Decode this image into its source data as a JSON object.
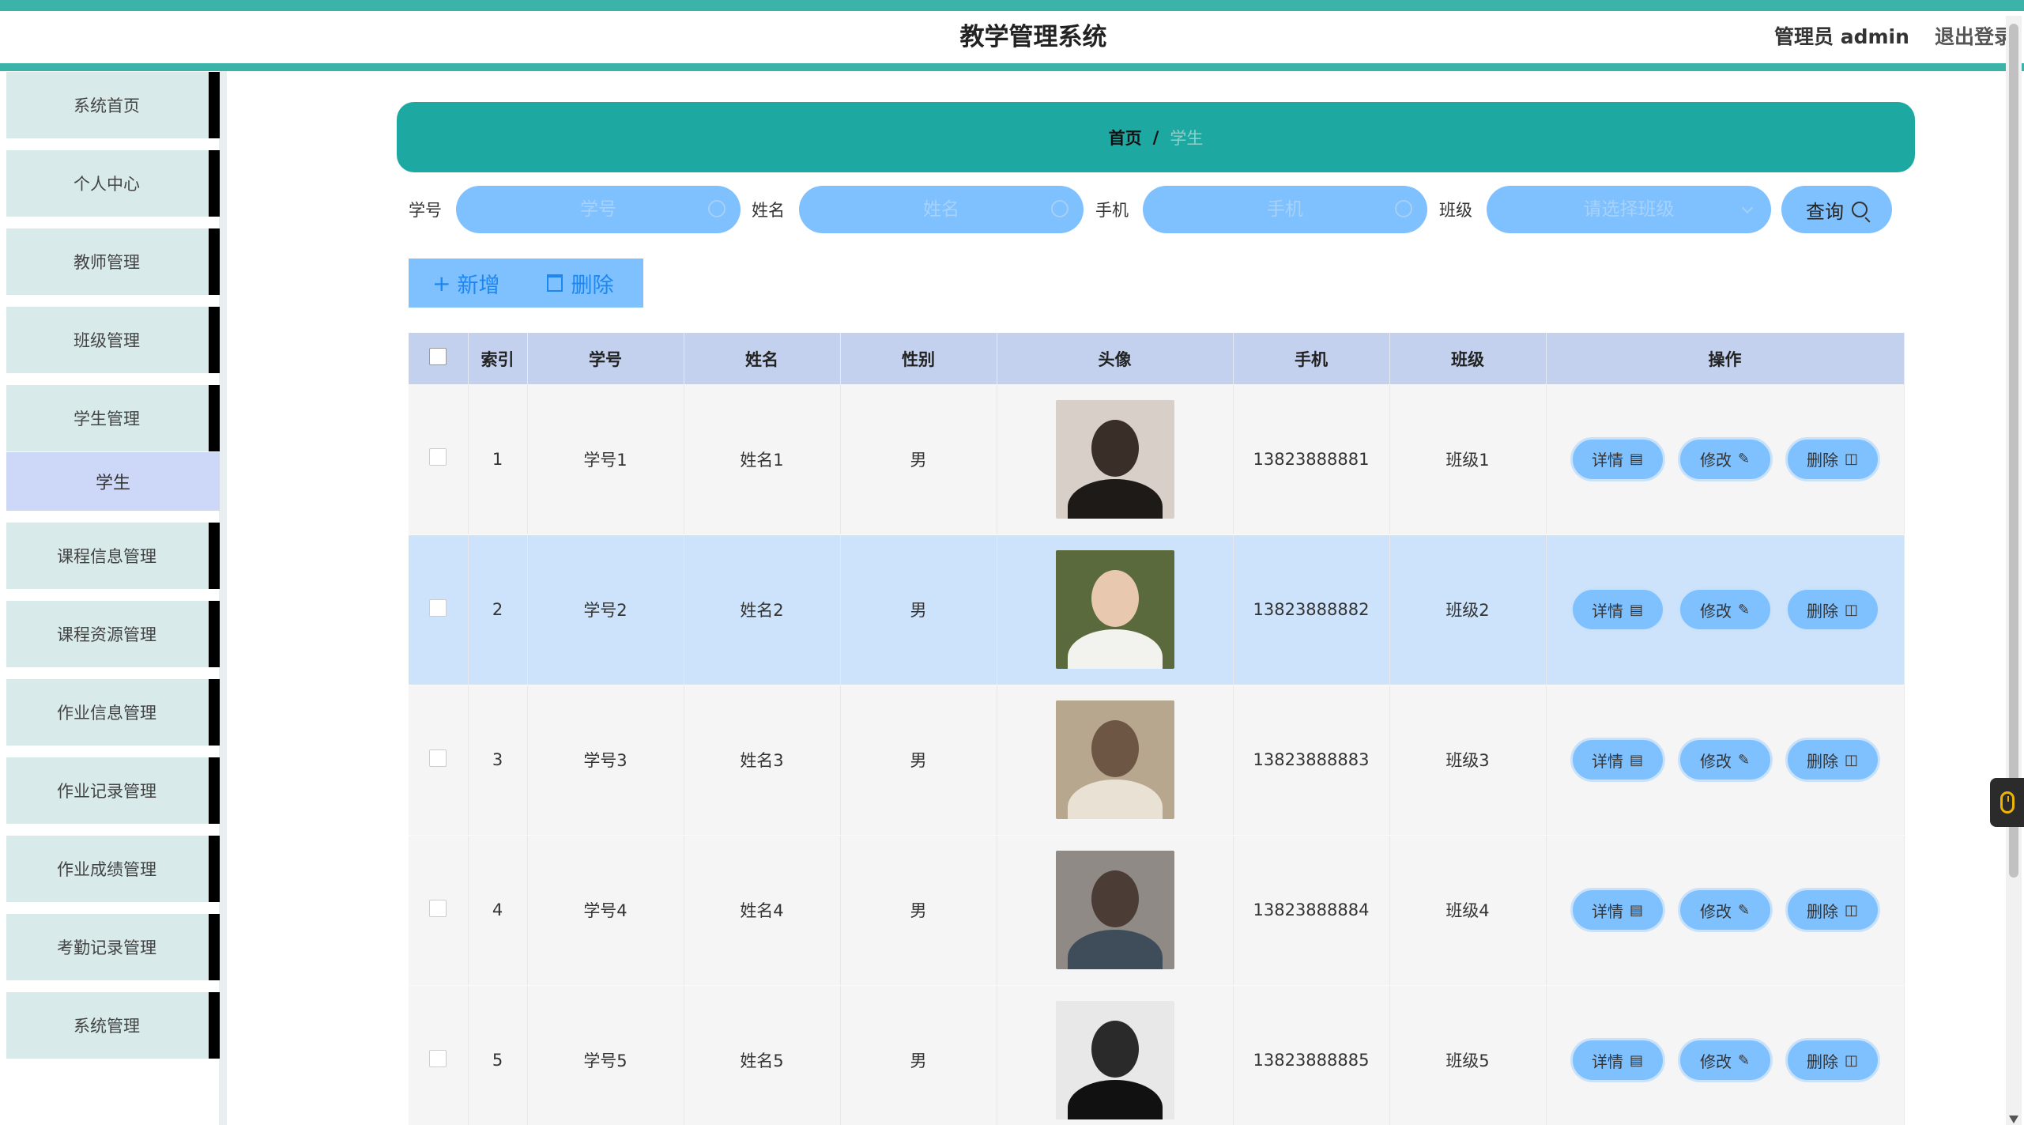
{
  "header": {
    "title": "教学管理系统",
    "admin": "管理员 admin",
    "logout": "退出登录"
  },
  "sidebar": {
    "items": [
      {
        "label": "系统首页"
      },
      {
        "label": "个人中心"
      },
      {
        "label": "教师管理"
      },
      {
        "label": "班级管理"
      },
      {
        "label": "学生管理"
      },
      {
        "label": "课程信息管理"
      },
      {
        "label": "课程资源管理"
      },
      {
        "label": "作业信息管理"
      },
      {
        "label": "作业记录管理"
      },
      {
        "label": "作业成绩管理"
      },
      {
        "label": "考勤记录管理"
      },
      {
        "label": "系统管理"
      }
    ],
    "submenu_active": "学生"
  },
  "breadcrumb": {
    "home": "首页",
    "separator": "/",
    "current": "学生"
  },
  "search": {
    "student_no_label": "学号",
    "student_no_placeholder": "学号",
    "name_label": "姓名",
    "name_placeholder": "姓名",
    "phone_label": "手机",
    "phone_placeholder": "手机",
    "class_label": "班级",
    "class_placeholder": "请选择班级",
    "query_button": "查询"
  },
  "toolbar": {
    "add_label": "新增",
    "delete_label": "删除"
  },
  "table": {
    "columns": [
      "",
      "索引",
      "学号",
      "姓名",
      "性别",
      "头像",
      "手机",
      "班级",
      "操作"
    ],
    "rows": [
      {
        "index": "1",
        "student_no": "学号1",
        "name": "姓名1",
        "gender": "男",
        "phone": "13823888881",
        "class": "班级1"
      },
      {
        "index": "2",
        "student_no": "学号2",
        "name": "姓名2",
        "gender": "男",
        "phone": "13823888882",
        "class": "班级2"
      },
      {
        "index": "3",
        "student_no": "学号3",
        "name": "姓名3",
        "gender": "男",
        "phone": "13823888883",
        "class": "班级3"
      },
      {
        "index": "4",
        "student_no": "学号4",
        "name": "姓名4",
        "gender": "男",
        "phone": "13823888884",
        "class": "班级4"
      },
      {
        "index": "5",
        "student_no": "学号5",
        "name": "姓名5",
        "gender": "男",
        "phone": "13823888885",
        "class": "班级5"
      }
    ],
    "actions": {
      "detail": "详情",
      "edit": "修改",
      "delete": "删除"
    },
    "highlighted_row": 2
  },
  "colors": {
    "accent": "#3bb3a9",
    "breadcrumb_bg": "#1ea8a2",
    "button_blue": "#7fc0ff",
    "header_row": "#c3d1ee",
    "highlight_row": "#cde3fb",
    "sidebar_item": "#d9eaea"
  }
}
